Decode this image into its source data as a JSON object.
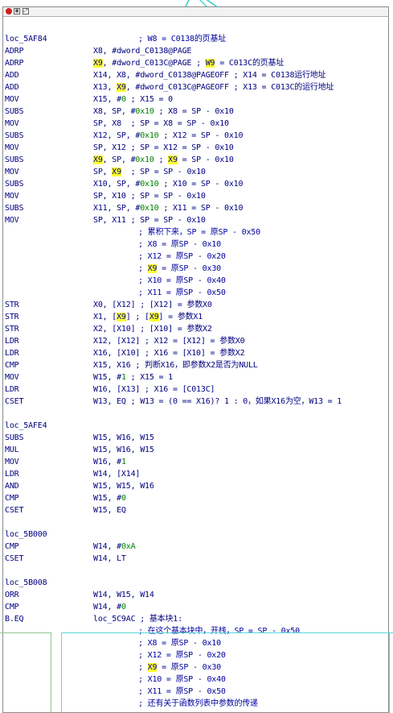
{
  "toolbar": {
    "icons": [
      "color-icon",
      "graph-overview-icon",
      "zoom-icon"
    ],
    "graph_glyph": "▦",
    "zoom_glyph": "⤢"
  },
  "highlight": {
    "register": "X9",
    "color": "#ffff30"
  },
  "lines": [
    {
      "type": "label",
      "text": "loc_5AF84",
      "comment": "; W8 = C0138的页基址"
    },
    {
      "type": "ins",
      "mn": "ADRP",
      "ops": [
        "X8, #dword_C0138@PAGE"
      ],
      "comment": ""
    },
    {
      "type": "ins",
      "mn": "ADRP",
      "ops": [
        "X9",
        "h",
        ", #dword_C013C@PAGE ; ",
        "W9",
        "h",
        " = C013C的页基址"
      ],
      "comment": ""
    },
    {
      "type": "ins",
      "mn": "ADD",
      "ops": [
        "X14, X8, #dword_C0138@PAGEOFF ; X14 = C0138运行地址"
      ],
      "comment": ""
    },
    {
      "type": "ins",
      "mn": "ADD",
      "ops": [
        "X13, ",
        "X9",
        "h",
        ", #dword_C013C@PAGEOFF ; X13 = C013C的运行地址"
      ],
      "comment": ""
    },
    {
      "type": "ins",
      "mn": "MOV",
      "ops": [
        "X15, #",
        "0",
        "n",
        " ; X15 = 0"
      ],
      "comment": ""
    },
    {
      "type": "ins",
      "mn": "SUBS",
      "ops": [
        "X8, SP, #",
        "0x10",
        "n",
        " ; X8 = SP - 0x10"
      ],
      "comment": ""
    },
    {
      "type": "ins",
      "mn": "MOV",
      "ops": [
        "SP, X8  ; SP = X8 = SP - 0x10"
      ],
      "comment": ""
    },
    {
      "type": "ins",
      "mn": "SUBS",
      "ops": [
        "X12, SP, #",
        "0x10",
        "n",
        " ; X12 = SP - 0x10"
      ],
      "comment": ""
    },
    {
      "type": "ins",
      "mn": "MOV",
      "ops": [
        "SP, X12 ; SP = X12 = SP - 0x10"
      ],
      "comment": ""
    },
    {
      "type": "ins",
      "mn": "SUBS",
      "ops": [
        "X9",
        "h",
        ", SP, #",
        "0x10",
        "n",
        " ; ",
        "X9",
        "h",
        " = SP - 0x10"
      ],
      "comment": ""
    },
    {
      "type": "ins",
      "mn": "MOV",
      "ops": [
        "SP, ",
        "X9",
        "h",
        "  ; SP = SP - 0x10"
      ],
      "comment": ""
    },
    {
      "type": "ins",
      "mn": "SUBS",
      "ops": [
        "X10, SP, #",
        "0x10",
        "n",
        " ; X10 = SP - 0x10"
      ],
      "comment": ""
    },
    {
      "type": "ins",
      "mn": "MOV",
      "ops": [
        "SP, X10 ; SP = SP - 0x10"
      ],
      "comment": ""
    },
    {
      "type": "ins",
      "mn": "SUBS",
      "ops": [
        "X11, SP, #",
        "0x10",
        "n",
        " ; X11 = SP - 0x10"
      ],
      "comment": ""
    },
    {
      "type": "ins",
      "mn": "MOV",
      "ops": [
        "SP, X11 ; SP = SP - 0x10"
      ],
      "comment": ""
    },
    {
      "type": "cmt",
      "parts": [
        "; 累积下来，SP = 原SP - 0x50"
      ]
    },
    {
      "type": "cmt",
      "parts": [
        "; X8 = 原SP - 0x10"
      ]
    },
    {
      "type": "cmt",
      "parts": [
        "; X12 = 原SP - 0x20"
      ]
    },
    {
      "type": "cmt",
      "parts": [
        "; ",
        "X9",
        "h",
        " = 原SP - 0x30"
      ]
    },
    {
      "type": "cmt",
      "parts": [
        "; X10 = 原SP - 0x40"
      ]
    },
    {
      "type": "cmt",
      "parts": [
        "; X11 = 原SP - 0x50"
      ]
    },
    {
      "type": "ins",
      "mn": "STR",
      "ops": [
        "X0, [X12] ; [X12] = 参数X0"
      ],
      "comment": ""
    },
    {
      "type": "ins",
      "mn": "STR",
      "ops": [
        "X1, [",
        "X9",
        "h",
        "] ; [",
        "X9",
        "h",
        "] = 参数X1"
      ],
      "comment": ""
    },
    {
      "type": "ins",
      "mn": "STR",
      "ops": [
        "X2, [X10] ; [X10] = 参数X2"
      ],
      "comment": ""
    },
    {
      "type": "ins",
      "mn": "LDR",
      "ops": [
        "X12, [X12] ; X12 = [X12] = 参数X0"
      ],
      "comment": ""
    },
    {
      "type": "ins",
      "mn": "LDR",
      "ops": [
        "X16, [X10] ; X16 = [X10] = 参数X2"
      ],
      "comment": ""
    },
    {
      "type": "ins",
      "mn": "CMP",
      "ops": [
        "X15, X16 ; 判断X16，即参数X2是否为NULL"
      ],
      "comment": ""
    },
    {
      "type": "ins",
      "mn": "MOV",
      "ops": [
        "W15, #",
        "1",
        "n",
        " ; X15 = 1"
      ],
      "comment": ""
    },
    {
      "type": "ins",
      "mn": "LDR",
      "ops": [
        "W16, [X13] ; X16 = [C013C]"
      ],
      "comment": ""
    },
    {
      "type": "ins",
      "mn": "CSET",
      "ops": [
        "W13, EQ ; W13 = (0 == X16)? 1 : 0，如果X16为空，W13 = 1"
      ],
      "comment": ""
    },
    {
      "type": "blank"
    },
    {
      "type": "label",
      "text": "loc_5AFE4",
      "comment": ""
    },
    {
      "type": "ins",
      "mn": "SUBS",
      "ops": [
        "W15, W16, W15"
      ],
      "comment": ""
    },
    {
      "type": "ins",
      "mn": "MUL",
      "ops": [
        "W15, W16, W15"
      ],
      "comment": ""
    },
    {
      "type": "ins",
      "mn": "MOV",
      "ops": [
        "W16, #",
        "1",
        "n"
      ],
      "comment": ""
    },
    {
      "type": "ins",
      "mn": "LDR",
      "ops": [
        "W14, [X14]"
      ],
      "comment": ""
    },
    {
      "type": "ins",
      "mn": "AND",
      "ops": [
        "W15, W15, W16"
      ],
      "comment": ""
    },
    {
      "type": "ins",
      "mn": "CMP",
      "ops": [
        "W15, #",
        "0",
        "n"
      ],
      "comment": ""
    },
    {
      "type": "ins",
      "mn": "CSET",
      "ops": [
        "W15, EQ"
      ],
      "comment": ""
    },
    {
      "type": "blank"
    },
    {
      "type": "label",
      "text": "loc_5B000",
      "comment": ""
    },
    {
      "type": "ins",
      "mn": "CMP",
      "ops": [
        "W14, #",
        "0xA",
        "n"
      ],
      "comment": ""
    },
    {
      "type": "ins",
      "mn": "CSET",
      "ops": [
        "W14, LT"
      ],
      "comment": ""
    },
    {
      "type": "blank"
    },
    {
      "type": "label",
      "text": "loc_5B008",
      "comment": ""
    },
    {
      "type": "ins",
      "mn": "ORR",
      "ops": [
        "W14, W15, W14"
      ],
      "comment": ""
    },
    {
      "type": "ins",
      "mn": "CMP",
      "ops": [
        "W14, #",
        "0",
        "n"
      ],
      "comment": ""
    },
    {
      "type": "ins",
      "mn": "B.EQ",
      "ops": [
        "loc_5C9AC ; 基本块1:"
      ],
      "comment": ""
    },
    {
      "type": "cmt",
      "parts": [
        "; 在这个基本块中，开栈，SP = SP - 0x50"
      ]
    },
    {
      "type": "cmt",
      "parts": [
        "; X8 = 原SP - 0x10"
      ]
    },
    {
      "type": "cmt",
      "parts": [
        "; X12 = 原SP - 0x20"
      ]
    },
    {
      "type": "cmt",
      "parts": [
        "; ",
        "X9",
        "h",
        " = 原SP - 0x30"
      ]
    },
    {
      "type": "cmt",
      "parts": [
        "; X10 = 原SP - 0x40"
      ]
    },
    {
      "type": "cmt",
      "parts": [
        "; X11 = 原SP - 0x50"
      ]
    },
    {
      "type": "cmt",
      "parts": [
        "; 还有关于函数列表中参数的传递"
      ]
    }
  ]
}
